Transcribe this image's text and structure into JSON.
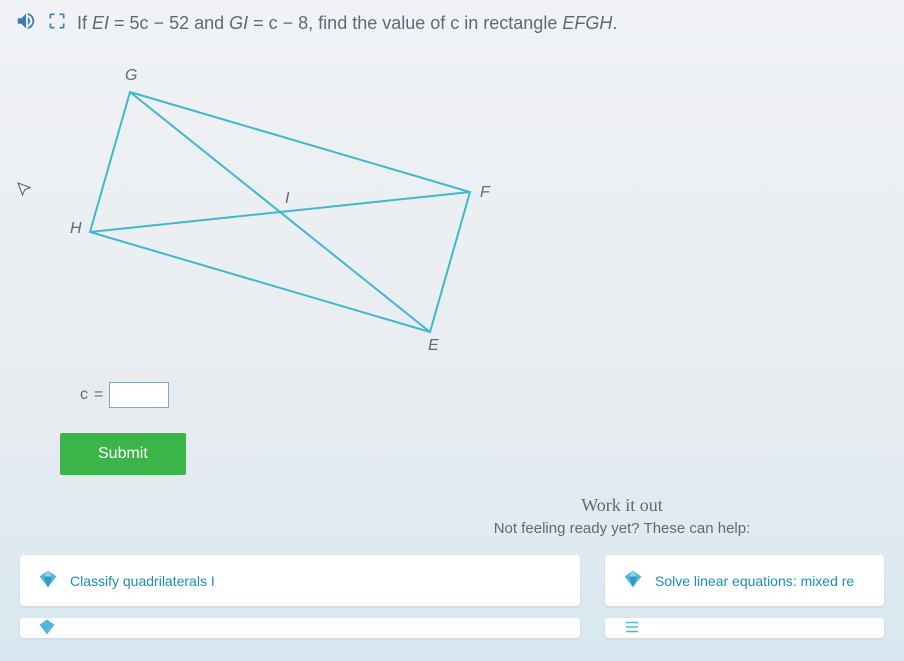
{
  "question": {
    "prefix": "If ",
    "var1": "EI",
    "eq1": " = 5c − 52 and ",
    "var2": "GI",
    "eq2": " = c − 8, find the value of c in rectangle ",
    "shape": "EFGH",
    "suffix": "."
  },
  "diagram": {
    "labels": {
      "G": "G",
      "H": "H",
      "I": "I",
      "F": "F",
      "E": "E"
    }
  },
  "answer": {
    "label_pre": "c",
    "equals": "=",
    "value": ""
  },
  "submit_label": "Submit",
  "work_it_out": "Work it out",
  "not_ready": "Not feeling ready yet? These can help:",
  "cards": {
    "classify": "Classify quadrilaterals I",
    "solve": "Solve linear equations: mixed re"
  }
}
